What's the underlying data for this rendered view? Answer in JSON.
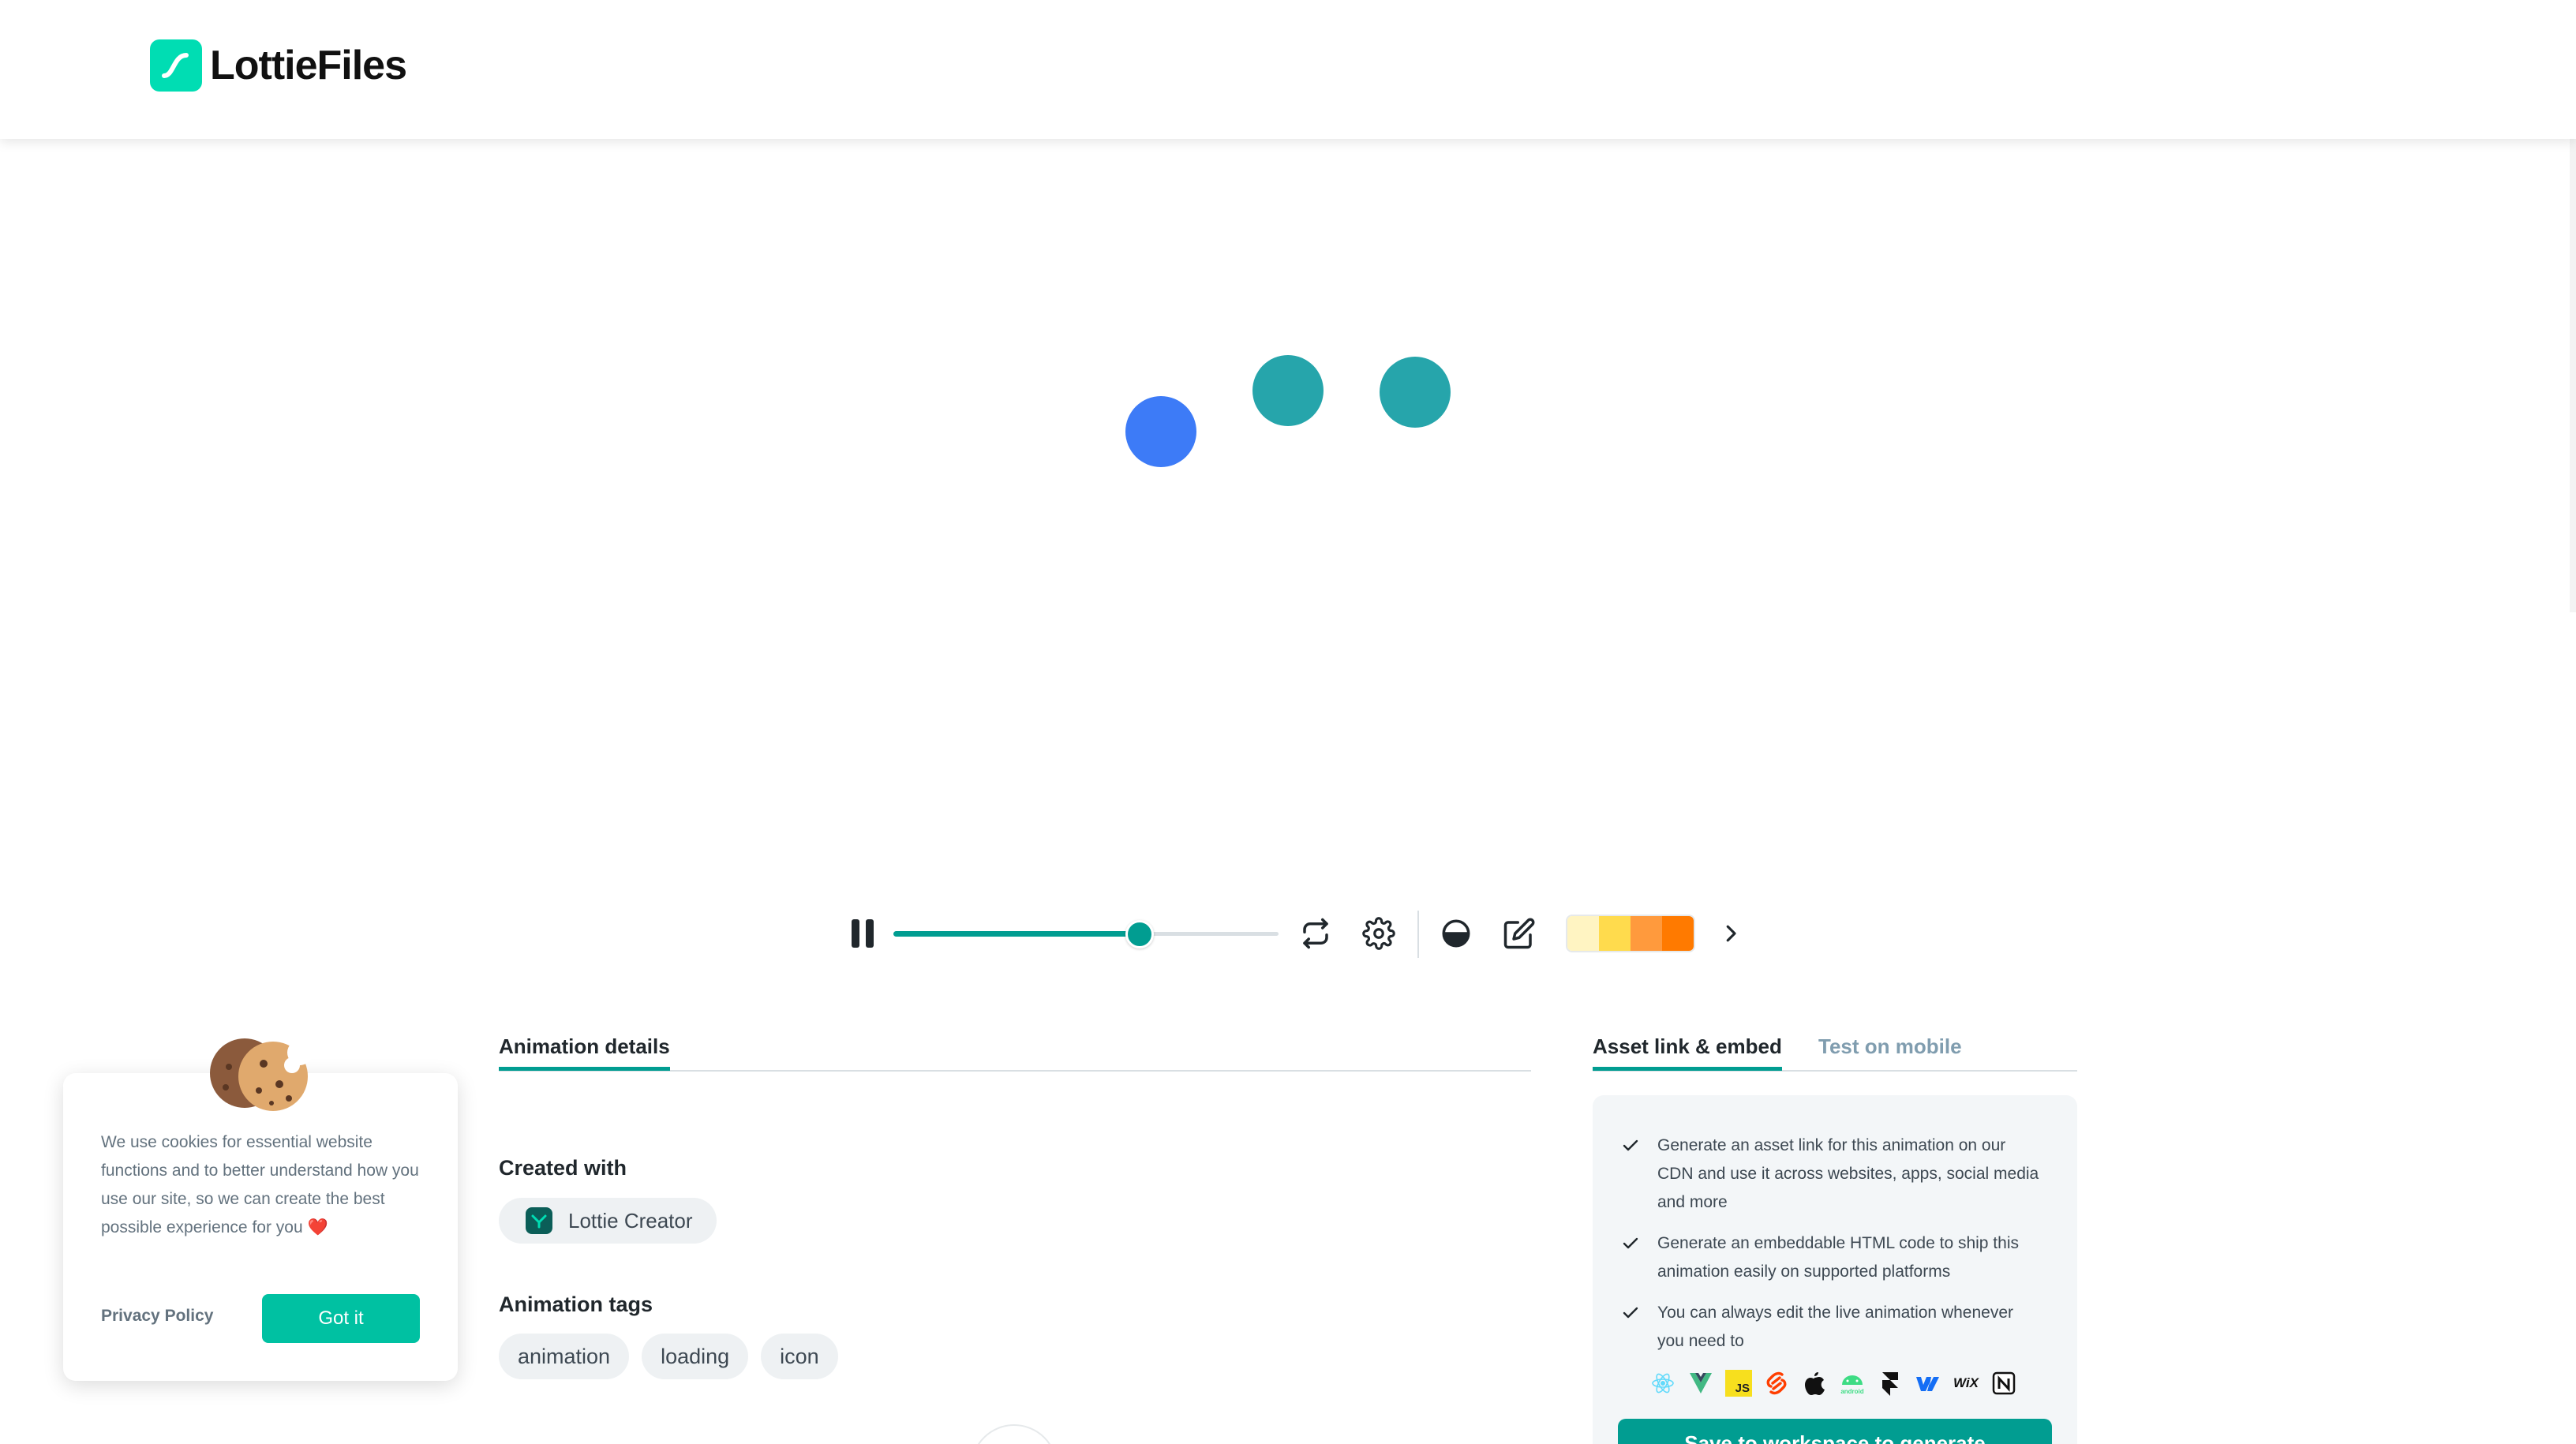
{
  "brand": {
    "name": "LottieFiles",
    "accent": "#019D91",
    "logo_bg": "#00DDB3"
  },
  "animation": {
    "dots": [
      {
        "color": "#3D7BF7"
      },
      {
        "color": "#26A5AB"
      },
      {
        "color": "#26A5AB"
      }
    ]
  },
  "player": {
    "state": "playing",
    "progress": 0.64,
    "palette": [
      "#FFF4C2",
      "#FFDB4D",
      "#FF9A3D",
      "#FF7A00"
    ]
  },
  "details": {
    "tab_label": "Animation details",
    "created_label": "Created with",
    "created_value": "Lottie Creator",
    "tags_label": "Animation tags",
    "tags": [
      "animation",
      "loading",
      "icon"
    ]
  },
  "asset": {
    "tabs": [
      "Asset link & embed",
      "Test on mobile"
    ],
    "bullets": [
      "Generate an asset link for this animation on our CDN and use it across websites, apps, social media and more",
      "Generate an embeddable HTML code to ship this animation easily on supported platforms",
      "You can always edit the live animation whenever you need to"
    ],
    "platform_icons": [
      "react-icon",
      "vue-icon",
      "js-icon",
      "svelte-icon",
      "apple-icon",
      "android-icon",
      "framer-icon",
      "webflow-icon",
      "wix-icon",
      "notion-icon"
    ],
    "save_button": "Save to workspace to generate"
  },
  "cookie": {
    "text": "We use cookies for essential website functions and to better understand how you use our site, so we can create the best possible experience for you",
    "heart": "❤️",
    "privacy_label": "Privacy Policy",
    "accept_label": "Got it"
  }
}
